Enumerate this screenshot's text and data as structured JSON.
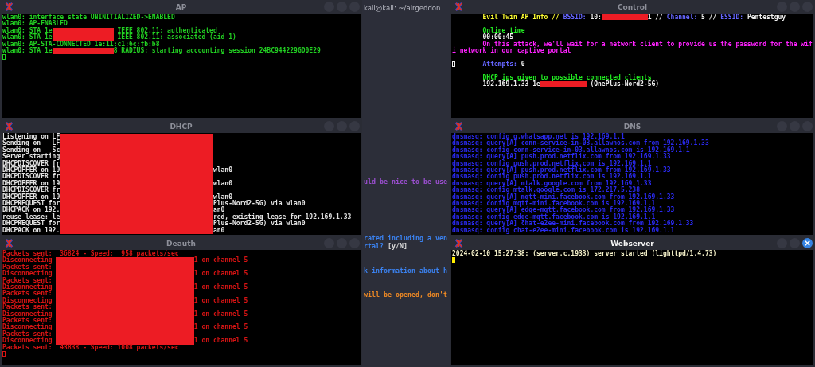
{
  "left_windows": [
    {
      "title": "AP",
      "active": false,
      "lines": [
        {
          "kind": "text",
          "text": "wlan0: interface state UNINITIALIZED->ENABLED"
        },
        {
          "kind": "text",
          "text": "wlan0: AP-ENABLED"
        },
        {
          "kind": "masked",
          "rows": [
            {
              "left": "wlan0: STA 1e",
              "right": " IEEE 802.11: authenticated"
            },
            {
              "left": "wlan0: STA 1e",
              "right": " IEEE 802.11: associated (aid 1)"
            }
          ]
        },
        {
          "kind": "text",
          "text": "wlan0: AP-STA-CONNECTED 1e:11:c1:6c:fb:b8"
        },
        {
          "kind": "masked",
          "rows": [
            {
              "left": "wlan0: STA 1e",
              "right": "8 RADIUS: starting accounting session 24BC944229GD0E29"
            }
          ]
        },
        {
          "kind": "cursor",
          "filled": false
        }
      ]
    },
    {
      "title": "DHCP",
      "active": false,
      "lines": [
        {
          "kind": "masked",
          "rows": [
            {
              "left": "Listening on LF"
            },
            {
              "left": "Sending on   LF"
            },
            {
              "left": "Sending on   Sc"
            },
            {
              "left": "Server starting"
            },
            {
              "left": "DHCPDISCOVER fr"
            },
            {
              "left": "DHCPOFFER on 19",
              "right": "wlan0"
            },
            {
              "left": "DHCPDISCOVER fr"
            },
            {
              "left": "DHCPOFFER on 19",
              "right": "wlan0"
            },
            {
              "left": "DHCPDISCOVER fr"
            },
            {
              "left": "DHCPOFFER on 19",
              "right": "wlan0"
            },
            {
              "left": "DHCPREQUEST for",
              "right": "Plus-Nord2-5G) via wlan0"
            },
            {
              "left": "DHCPACK on 192.",
              "right": "an0"
            },
            {
              "left": "reuse_lease: le",
              "right": "red, existing lease for 192.169.1.33"
            },
            {
              "left": "DHCPREQUEST for",
              "right": "Plus-Nord2-5G) via wlan0"
            },
            {
              "left": "DHCPACK on 192.",
              "right": "an0"
            }
          ]
        }
      ]
    },
    {
      "title": "Deauth",
      "active": false,
      "lines": [
        {
          "kind": "text",
          "text": "Packets sent:  36824 - Speed:  958 packets/sec"
        },
        {
          "kind": "masked",
          "rows": [
            {
              "left": "Disconnecting ",
              "right": "1 on channel 5"
            },
            {
              "left": "Packets sent: "
            },
            {
              "left": "Disconnecting ",
              "right": "1 on channel 5"
            },
            {
              "left": "Packets sent: "
            },
            {
              "left": "Disconnecting ",
              "right": "1 on channel 5"
            },
            {
              "left": "Packets sent: "
            },
            {
              "left": "Disconnecting ",
              "right": "1 on channel 5"
            },
            {
              "left": "Packets sent: "
            },
            {
              "left": "Disconnecting ",
              "right": "1 on channel 5"
            },
            {
              "left": "Packets sent: "
            },
            {
              "left": "Disconnecting ",
              "right": "1 on channel 5"
            },
            {
              "left": "Packets sent: "
            },
            {
              "left": "Disconnecting ",
              "right": "1 on channel 5"
            }
          ]
        },
        {
          "kind": "text",
          "text": "Packets sent:  43838 - Speed: 1008 packets/sec"
        },
        {
          "kind": "cursor",
          "filled": false
        }
      ]
    }
  ],
  "background_terminal": {
    "title": "kali@kali: ~/airgeddon",
    "lines": [
      {
        "spans": [
          {
            "text": "uld be nice to be use",
            "color": "#9b4fd0"
          }
        ]
      },
      {
        "spans": [
          {
            "text": "rated including a ven",
            "color": "#3b82f0"
          }
        ]
      },
      {
        "spans": [
          {
            "text": "rtal?",
            "color": "#3b82f0"
          },
          {
            "text": " [y/N]",
            "color": "#d8d8d8"
          }
        ]
      },
      {
        "spans": [
          {
            "text": "k information about h",
            "color": "#3b82f0"
          }
        ]
      },
      {
        "spans": [
          {
            "text": "will be opened, don't",
            "color": "#f08a24"
          }
        ]
      }
    ]
  },
  "right_windows": [
    {
      "title": "Control",
      "active": false,
      "lines": [
        {
          "kind": "rich",
          "spans": [
            {
              "kind": "text",
              "text": "Evil Twin AP Info // ",
              "color": "#ffff33"
            },
            {
              "kind": "text",
              "text": "BSSID:",
              "color": "#6666ff"
            },
            {
              "kind": "text",
              "text": " 10:",
              "color": "#f0f0f0"
            },
            {
              "kind": "redaction"
            },
            {
              "kind": "text",
              "text": "1 // ",
              "color": "#f0f0f0"
            },
            {
              "kind": "text",
              "text": "Channel:",
              "color": "#6666ff"
            },
            {
              "kind": "text",
              "text": " 5 // ",
              "color": "#f0f0f0"
            },
            {
              "kind": "text",
              "text": "ESSID:",
              "color": "#6666ff"
            },
            {
              "kind": "text",
              "text": " Pentestguy",
              "color": "#f0f0f0"
            }
          ]
        },
        {
          "kind": "gap"
        },
        {
          "kind": "text",
          "text": "Online time",
          "color": "#22ee22"
        },
        {
          "kind": "text",
          "text": "00:00:45"
        },
        {
          "kind": "text",
          "text": "On this attack, we'll wait for a network client to provide us the password for the wifi network in our captive portal",
          "color": "#ff22ff"
        },
        {
          "kind": "gap"
        },
        {
          "kind": "rich",
          "spans": [
            {
              "kind": "cursor"
            },
            {
              "kind": "text",
              "text": "Attempts:",
              "color": "#6666ff"
            },
            {
              "kind": "text",
              "text": " 0",
              "color": "#f0f0f0"
            }
          ]
        },
        {
          "kind": "gap"
        },
        {
          "kind": "text",
          "text": "DHCP ips given to possible connected clients",
          "color": "#22ee22"
        },
        {
          "kind": "rich",
          "spans": [
            {
              "kind": "text",
              "text": "192.169.1.33 1e",
              "color": "#f0f0f0"
            },
            {
              "kind": "redaction"
            },
            {
              "kind": "text",
              "text": " (OnePlus-Nord2-5G)",
              "color": "#f0f0f0"
            }
          ]
        }
      ]
    },
    {
      "title": "DNS",
      "active": false,
      "lines": [
        {
          "kind": "text",
          "text": "dnsmasq: config g.whatsapp.net is 192.169.1.1"
        },
        {
          "kind": "text",
          "text": "dnsmasq: query[A] conn-service-in-03.allawnos.com from 192.169.1.33"
        },
        {
          "kind": "text",
          "text": "dnsmasq: config conn-service-in-03.allawnos.com is 192.169.1.1"
        },
        {
          "kind": "text",
          "text": "dnsmasq: query[A] push.prod.netflix.com from 192.169.1.33"
        },
        {
          "kind": "text",
          "text": "dnsmasq: config push.prod.netflix.com is 192.169.1.1"
        },
        {
          "kind": "text",
          "text": "dnsmasq: query[A] push.prod.netflix.com from 192.169.1.33"
        },
        {
          "kind": "text",
          "text": "dnsmasq: config push.prod.netflix.com is 192.169.1.1"
        },
        {
          "kind": "text",
          "text": "dnsmasq: query[A] mtalk.google.com from 192.169.1.33"
        },
        {
          "kind": "text",
          "text": "dnsmasq: config mtalk.google.com is 172.217.5.238"
        },
        {
          "kind": "text",
          "text": "dnsmasq: query[A] mqtt-mini.facebook.com from 192.169.1.33"
        },
        {
          "kind": "text",
          "text": "dnsmasq: config mqtt-mini.facebook.com is 192.169.1.1"
        },
        {
          "kind": "text",
          "text": "dnsmasq: query[A] edge-mqtt.facebook.com from 192.169.1.33"
        },
        {
          "kind": "text",
          "text": "dnsmasq: config edge-mqtt.facebook.com is 192.169.1.1"
        },
        {
          "kind": "text",
          "text": "dnsmasq: query[A] chat-e2ee-mini.facebook.com from 192.169.1.33"
        },
        {
          "kind": "text",
          "text": "dnsmasq: config chat-e2ee-mini.facebook.com is 192.169.1.1"
        }
      ]
    },
    {
      "title": "Webserver",
      "active": true,
      "lines": [
        {
          "kind": "text",
          "text": "2024-02-10 15:27:38: (server.c.1933) server started (lighttpd/1.4.73)"
        },
        {
          "kind": "cursor",
          "filled": true
        }
      ]
    }
  ]
}
